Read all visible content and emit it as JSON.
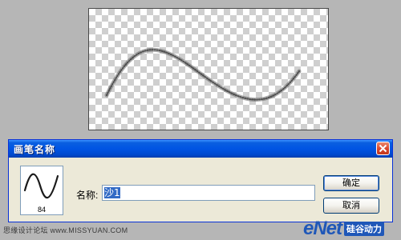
{
  "dialog": {
    "title": "画笔名称",
    "name_label": "名称:",
    "name_value": "沙1",
    "brush_size": "84",
    "ok_label": "确定",
    "cancel_label": "取消"
  },
  "icons": {
    "close": "close-icon",
    "brush_stroke": "brush-stroke-preview"
  },
  "watermarks": {
    "left": "思缘设计论坛 www.MISSYUAN.COM",
    "right_brand": "eNet",
    "right_tag": "硅谷动力"
  },
  "colors": {
    "titlebar": "#0054e3",
    "dialog_bg": "#ece9d8",
    "selection": "#316ac5",
    "close_button": "#d9442a",
    "workspace": "#b6b6b6",
    "brand": "#1f57b8"
  }
}
